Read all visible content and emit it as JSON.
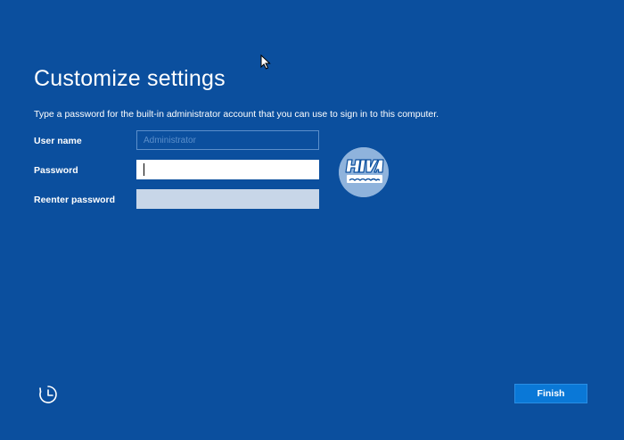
{
  "page": {
    "title": "Customize settings",
    "description": "Type a password for the built-in administrator account that you can use to sign in to this computer."
  },
  "form": {
    "username_label": "User name",
    "username_placeholder": "Administrator",
    "password_label": "Password",
    "reenter_label": "Reenter password"
  },
  "footer": {
    "accessibility_icon": "ease-of-access-icon",
    "finish_label": "Finish"
  },
  "watermark": {
    "logo_text_latin": "HIVA",
    "logo_text_persian": "هیواشبکه"
  },
  "colors": {
    "background": "#0b4f9e",
    "finish_button": "#0a78d7",
    "text": "#ffffff"
  }
}
